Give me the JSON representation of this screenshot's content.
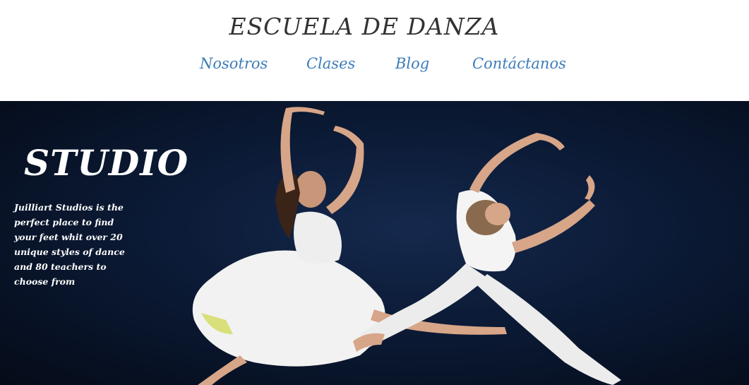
{
  "header": {
    "site_title": "ESCUELA DE DANZA",
    "nav": [
      {
        "label": "Nosotros"
      },
      {
        "label": "Clases"
      },
      {
        "label": "Blog"
      },
      {
        "label": "Contáctanos"
      }
    ]
  },
  "hero": {
    "title": "STUDIO",
    "description": "Juilliart Studios is the perfect place to find your feet whit over 20 unique styles of dance and 80 teachers to choose from",
    "image": "two-dancers-leaping-photo"
  },
  "colors": {
    "nav_link": "#3d7cb8",
    "title": "#333333",
    "hero_background": "#0b1a35"
  }
}
